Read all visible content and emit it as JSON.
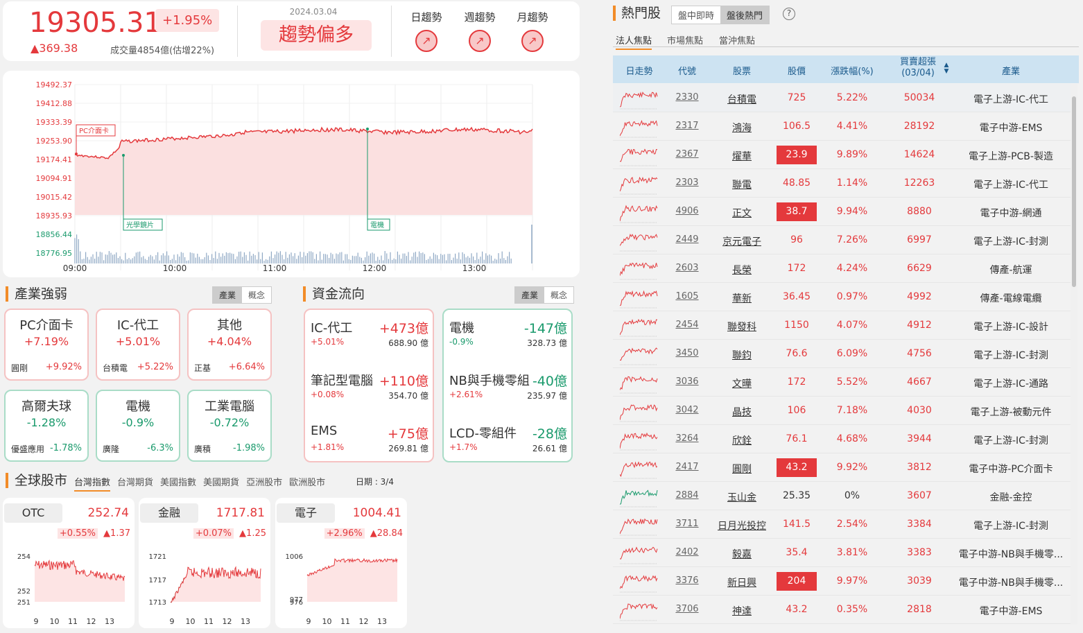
{
  "index": {
    "value": "19305.31",
    "pct": "+1.95%",
    "change": "▲369.38",
    "volume": "成交量4854億(估增22%)",
    "date": "2024.03.04",
    "trend": "趨勢偏多",
    "trend_tabs": [
      "日趨勢",
      "週趨勢",
      "月趨勢"
    ]
  },
  "main_chart": {
    "y_ticks": [
      "19492.37",
      "19412.88",
      "19333.39",
      "19253.90",
      "19174.41",
      "19094.91",
      "19015.42",
      "18935.93",
      "18856.44",
      "18776.95"
    ],
    "x_ticks": [
      "09:00",
      "10:00",
      "11:00",
      "12:00",
      "13:00"
    ],
    "annotations": [
      "PC介面卡",
      "光學鏡片",
      "電機"
    ]
  },
  "industry": {
    "title": "產業強弱",
    "toggle": [
      "產業",
      "概念"
    ],
    "items": [
      {
        "name": "PC介面卡",
        "pct": "+7.19%",
        "stock": "圓剛",
        "spct": "+9.92%",
        "up": true
      },
      {
        "name": "IC-代工",
        "pct": "+5.01%",
        "stock": "台積電",
        "spct": "+5.22%",
        "up": true
      },
      {
        "name": "其他",
        "pct": "+4.04%",
        "stock": "正基",
        "spct": "+6.64%",
        "up": true
      },
      {
        "name": "高爾夫球",
        "pct": "-1.28%",
        "stock": "優盛應用",
        "spct": "-1.78%",
        "up": false
      },
      {
        "name": "電機",
        "pct": "-0.9%",
        "stock": "廣隆",
        "spct": "-6.3%",
        "up": false
      },
      {
        "name": "工業電腦",
        "pct": "-0.72%",
        "stock": "廣積",
        "spct": "-1.98%",
        "up": false
      }
    ]
  },
  "flow": {
    "title": "資金流向",
    "toggle": [
      "產業",
      "概念"
    ],
    "inflow": [
      {
        "name": "IC-代工",
        "amt": "+473億",
        "pct": "+5.01%",
        "vol": "688.90 億"
      },
      {
        "name": "筆記型電腦",
        "amt": "+110億",
        "pct": "+0.08%",
        "vol": "354.70 億"
      },
      {
        "name": "EMS",
        "amt": "+75億",
        "pct": "+1.81%",
        "vol": "269.81 億"
      }
    ],
    "outflow": [
      {
        "name": "電機",
        "amt": "-147億",
        "pct": "-0.9%",
        "vol": "328.73 億"
      },
      {
        "name": "NB與手機零組",
        "amt": "-40億",
        "pct": "+2.61%",
        "vol": "235.97 億"
      },
      {
        "name": "LCD-零組件",
        "amt": "-28億",
        "pct": "+1.7%",
        "vol": "26.61 億"
      }
    ]
  },
  "global": {
    "title": "全球股市",
    "tabs": [
      "台灣指數",
      "台灣期貨",
      "美國指數",
      "美國期貨",
      "亞洲股市",
      "歐洲股市"
    ],
    "date": "日期 : 3/4",
    "cards": [
      {
        "name": "OTC",
        "val": "252.74",
        "pct": "+0.55%",
        "chg": "▲1.37",
        "yt": [
          "254",
          "252",
          "251"
        ],
        "xt": [
          "9",
          "10",
          "11",
          "12",
          "13"
        ]
      },
      {
        "name": "金融",
        "val": "1717.81",
        "pct": "+0.07%",
        "chg": "▲1.25",
        "yt": [
          "1721",
          "1717",
          "1713"
        ],
        "xt": [
          "9",
          "10",
          "11",
          "12",
          "13"
        ]
      },
      {
        "name": "電子",
        "val": "1004.41",
        "pct": "+2.96%",
        "chg": "▲28.84",
        "yt": [
          "1006",
          "977",
          "976"
        ],
        "xt": [
          "9",
          "10",
          "11",
          "12",
          "13"
        ]
      }
    ]
  },
  "hot": {
    "title": "熱門股",
    "toggle": [
      "盤中即時",
      "盤後熱門"
    ],
    "help": "?",
    "subtabs": [
      "法人焦點",
      "市場焦點",
      "當沖焦點"
    ],
    "headers": [
      "日走勢",
      "代號",
      "股票",
      "股價",
      "漲跌幅(%)",
      "買賣超張",
      "(03/04)",
      "產業"
    ],
    "rows": [
      {
        "code": "2330",
        "name": "台積電",
        "price": "725",
        "pct": "5.22%",
        "buy": "50034",
        "ind": "電子上游-IC-代工",
        "lim": false
      },
      {
        "code": "2317",
        "name": "鴻海",
        "price": "106.5",
        "pct": "4.41%",
        "buy": "28192",
        "ind": "電子中游-EMS",
        "lim": false
      },
      {
        "code": "2367",
        "name": "燿華",
        "price": "23.9",
        "pct": "9.89%",
        "buy": "14624",
        "ind": "電子上游-PCB-製造",
        "lim": true
      },
      {
        "code": "2303",
        "name": "聯電",
        "price": "48.85",
        "pct": "1.14%",
        "buy": "12263",
        "ind": "電子上游-IC-代工",
        "lim": false
      },
      {
        "code": "4906",
        "name": "正文",
        "price": "38.7",
        "pct": "9.94%",
        "buy": "8880",
        "ind": "電子中游-網通",
        "lim": true
      },
      {
        "code": "2449",
        "name": "京元電子",
        "price": "96",
        "pct": "7.26%",
        "buy": "6997",
        "ind": "電子上游-IC-封測",
        "lim": false
      },
      {
        "code": "2603",
        "name": "長榮",
        "price": "172",
        "pct": "4.24%",
        "buy": "6629",
        "ind": "傳產-航運",
        "lim": false
      },
      {
        "code": "1605",
        "name": "華新",
        "price": "36.45",
        "pct": "0.97%",
        "buy": "4992",
        "ind": "傳產-電線電纜",
        "lim": false
      },
      {
        "code": "2454",
        "name": "聯發科",
        "price": "1150",
        "pct": "4.07%",
        "buy": "4912",
        "ind": "電子上游-IC-設計",
        "lim": false
      },
      {
        "code": "3450",
        "name": "聯鈞",
        "price": "76.6",
        "pct": "6.09%",
        "buy": "4756",
        "ind": "電子上游-IC-封測",
        "lim": false
      },
      {
        "code": "3036",
        "name": "文曄",
        "price": "172",
        "pct": "5.52%",
        "buy": "4667",
        "ind": "電子上游-IC-通路",
        "lim": false
      },
      {
        "code": "3042",
        "name": "晶技",
        "price": "106",
        "pct": "7.18%",
        "buy": "4030",
        "ind": "電子上游-被動元件",
        "lim": false
      },
      {
        "code": "3264",
        "name": "欣銓",
        "price": "76.1",
        "pct": "4.68%",
        "buy": "3944",
        "ind": "電子上游-IC-封測",
        "lim": false
      },
      {
        "code": "2417",
        "name": "圓剛",
        "price": "43.2",
        "pct": "9.92%",
        "buy": "3812",
        "ind": "電子中游-PC介面卡",
        "lim": true
      },
      {
        "code": "2884",
        "name": "玉山金",
        "price": "25.35",
        "pct": "0%",
        "buy": "3607",
        "ind": "金融-金控",
        "lim": false
      },
      {
        "code": "3711",
        "name": "日月光投控",
        "price": "141.5",
        "pct": "2.54%",
        "buy": "3384",
        "ind": "電子上游-IC-封測",
        "lim": false
      },
      {
        "code": "2402",
        "name": "毅嘉",
        "price": "35.4",
        "pct": "3.81%",
        "buy": "3383",
        "ind": "電子中游-NB與手機零...",
        "lim": false
      },
      {
        "code": "3376",
        "name": "新日興",
        "price": "204",
        "pct": "9.97%",
        "buy": "3039",
        "ind": "電子中游-NB與手機零...",
        "lim": true
      },
      {
        "code": "3706",
        "name": "神達",
        "price": "43.2",
        "pct": "0.35%",
        "buy": "2818",
        "ind": "電子中游-EMS",
        "lim": false
      }
    ]
  }
}
